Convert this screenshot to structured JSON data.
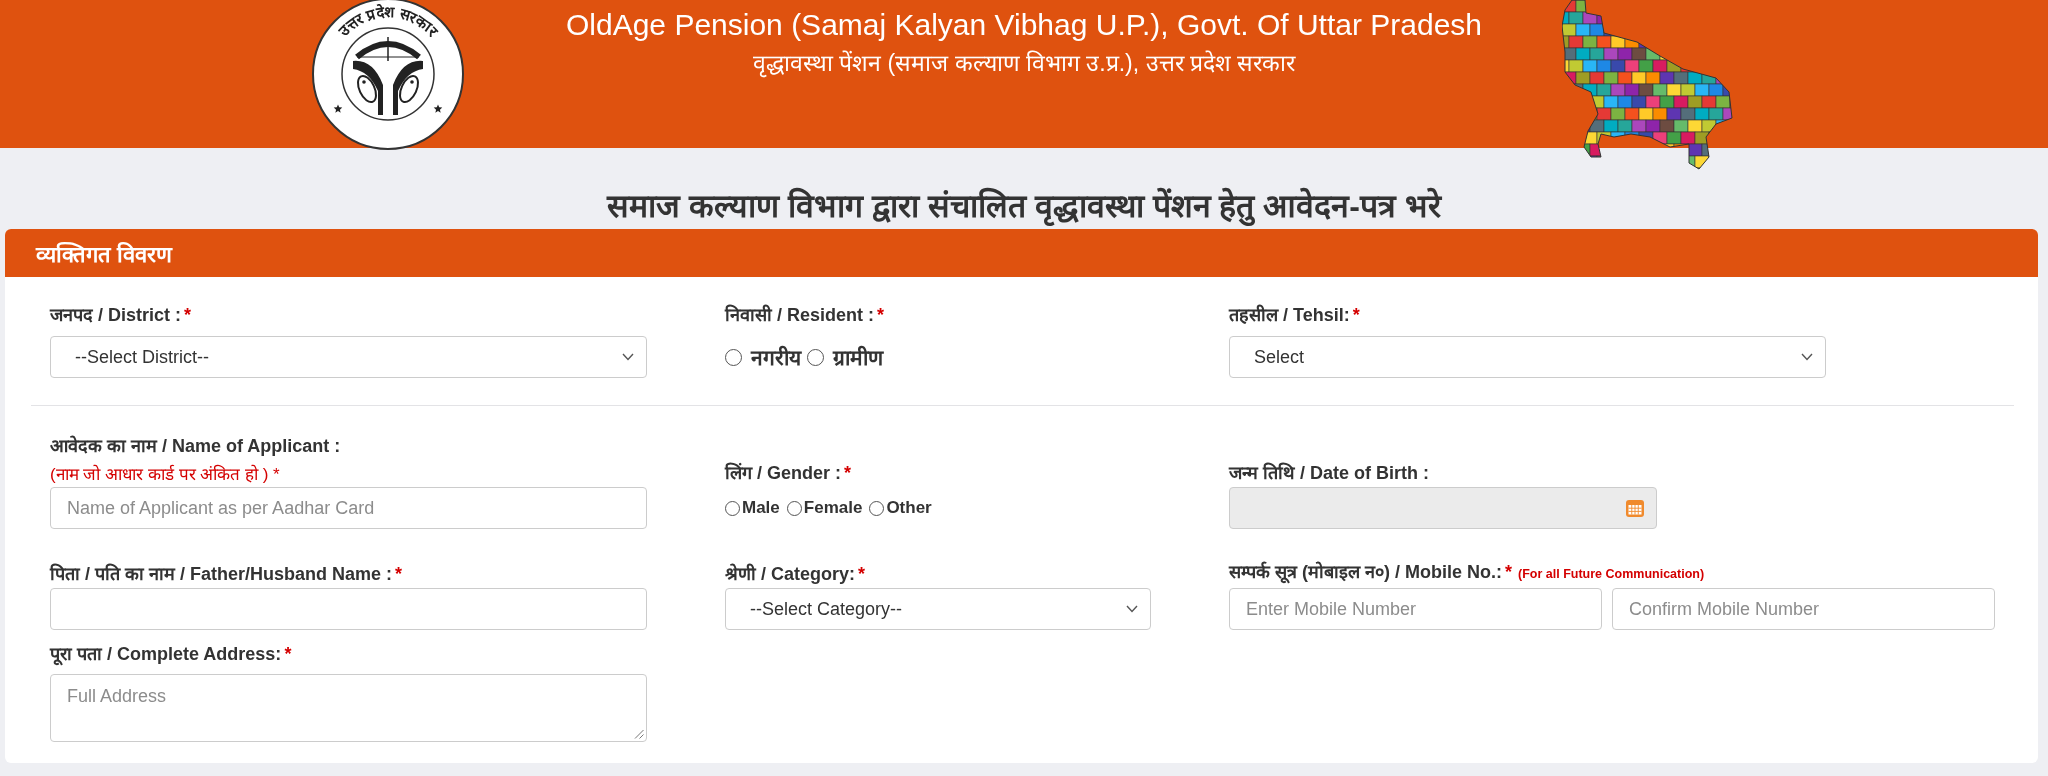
{
  "header": {
    "title": "OldAge Pension (Samaj Kalyan Vibhag U.P.), Govt. Of Uttar Pradesh",
    "subtitle": "वृद्धावस्था पेंशन (समाज कल्याण विभाग उ.प्र.), उत्तर प्रदेश सरकार",
    "emblem_text": "उत्तर प्रदेश सरकार"
  },
  "page_heading": "समाज कल्याण विभाग द्वारा संचालित वृद्धावस्था पेंशन हेतु आवेदन-पत्र भरे",
  "section": {
    "title": "व्यक्तिगत विवरण"
  },
  "form_sections": [
    {
      "rows": [
        [
          {
            "kind": "select",
            "label": "जनपद / District :",
            "required_mark": "*",
            "value": "--Select District--"
          },
          {
            "kind": "radio",
            "label": "निवासी / Resident :",
            "required_mark": "*",
            "options": [
              {
                "label": "नगरीय",
                "selected": false
              },
              {
                "label": "ग्रामीण",
                "selected": false
              }
            ]
          },
          {
            "kind": "select",
            "label": "तहसील / Tehsil:",
            "required_mark": "*",
            "value": "Select"
          }
        ]
      ]
    },
    {
      "rows": [
        [
          {
            "kind": "text",
            "label": "आवेदक का नाम / Name of Applicant :",
            "hint": "(नाम जो आधार कार्ड पर अंकित हो ) *",
            "placeholder": "Name of Applicant as per Aadhar Card"
          },
          {
            "kind": "radio",
            "label": "लिंग / Gender :",
            "required_mark": "*",
            "options": [
              {
                "label": "Male",
                "selected": false
              },
              {
                "label": "Female",
                "selected": false
              },
              {
                "label": "Other",
                "selected": false
              }
            ]
          },
          {
            "kind": "date",
            "label": "जन्म तिथि / Date of Birth :",
            "disabled": true
          }
        ],
        [
          {
            "kind": "text",
            "label": "पिता / पति का नाम / Father/Husband Name :",
            "required_mark": "*"
          },
          {
            "kind": "select",
            "label": "श्रेणी / Category:",
            "required_mark": "*",
            "value": "--Select Category--"
          },
          {
            "kind": "phone_pair",
            "label": "सम्पर्क सूत्र (मोबाइल न०) / Mobile No.:",
            "required_mark": "*",
            "note": "(For all Future Communication)",
            "inputs": [
              {
                "placeholder": "Enter Mobile Number"
              },
              {
                "placeholder": "Confirm Mobile Number"
              }
            ]
          }
        ],
        [
          {
            "kind": "textarea",
            "label": "पूरा पता / Complete Address:",
            "required_mark": "*",
            "placeholder": "Full Address"
          }
        ]
      ]
    }
  ]
}
